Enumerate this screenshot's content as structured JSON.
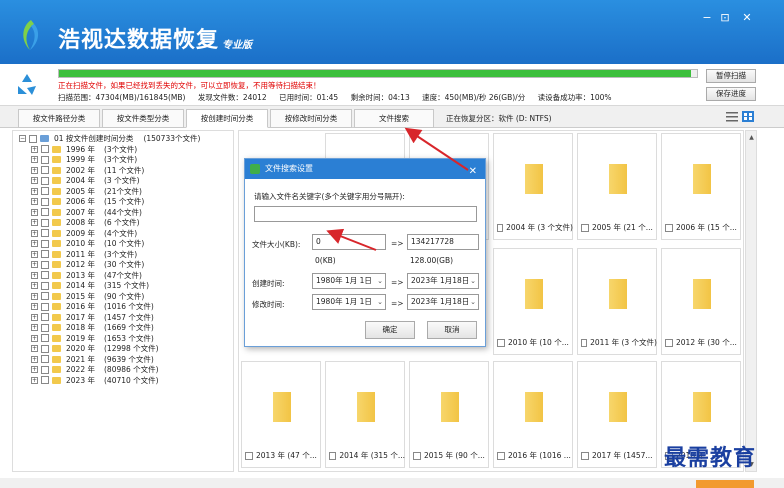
{
  "app": {
    "title": "浩视达数据恢复",
    "edition": "专业版"
  },
  "window_controls": {
    "minimize": "−",
    "restore": "⊡",
    "close": "✕"
  },
  "scan": {
    "progress": 0.99,
    "warning": "正在扫描文件，如果已经找到丢失的文件，可以立即恢复，不用等待扫描结束！",
    "stats": {
      "range": "扫描范围：47304(MB)/161845(MB)",
      "found": "发现文件数：24012",
      "elapsed": "已用时间：01:45",
      "remaining": "剩余时间：04:13",
      "speed": "速度：450(MB)/秒 26(GB)/分",
      "success_rate": "读设备成功率：100%"
    },
    "pause_label": "暂停扫描",
    "save_label": "保存进度"
  },
  "tabs": [
    {
      "label": "按文件路径分类"
    },
    {
      "label": "按文件类型分类"
    },
    {
      "label": "按创建时间分类"
    },
    {
      "label": "按修改时间分类"
    },
    {
      "label": "文件搜索"
    }
  ],
  "restore_area": "正在恢复分区：软件 (D: NTFS)",
  "tree": {
    "root": "01 按文件创建时间分类",
    "root_count": "(150733个文件)",
    "items": [
      {
        "year": "1996 年",
        "count": "(3个文件)"
      },
      {
        "year": "1999 年",
        "count": "(3个文件)"
      },
      {
        "year": "2002 年",
        "count": "(11 个文件)"
      },
      {
        "year": "2004 年",
        "count": "(3 个文件)"
      },
      {
        "year": "2005 年",
        "count": "(21个文件)"
      },
      {
        "year": "2006 年",
        "count": "(15 个文件)"
      },
      {
        "year": "2007 年",
        "count": "(44个文件)"
      },
      {
        "year": "2008 年",
        "count": "(6 个文件)"
      },
      {
        "year": "2009 年",
        "count": "(4个文件)"
      },
      {
        "year": "2010 年",
        "count": "(10 个文件)"
      },
      {
        "year": "2011 年",
        "count": "(3个文件)"
      },
      {
        "year": "2012 年",
        "count": "(30 个文件)"
      },
      {
        "year": "2013 年",
        "count": "(47个文件)"
      },
      {
        "year": "2014 年",
        "count": "(315 个文件)"
      },
      {
        "year": "2015 年",
        "count": "(90 个文件)"
      },
      {
        "year": "2016 年",
        "count": "(1016 个文件)"
      },
      {
        "year": "2017 年",
        "count": "(1457 个文件)"
      },
      {
        "year": "2018 年",
        "count": "(1669 个文件)"
      },
      {
        "year": "2019 年",
        "count": "(1653 个文件)"
      },
      {
        "year": "2020 年",
        "count": "(12998 个文件)"
      },
      {
        "year": "2021 年",
        "count": "(9639 个文件)"
      },
      {
        "year": "2022 年",
        "count": "(80986 个文件)"
      },
      {
        "year": "2023 年",
        "count": "(40710 个文件)"
      }
    ]
  },
  "grid": {
    "row1": [
      "",
      "",
      "2004 年 (3 个文件)",
      "2005 年 (21 个...",
      "2006 年 (15 个..."
    ],
    "row2": [
      "2010 年 (10 个...",
      "2011 年 (3 个文件)",
      "2012 年 (30 个..."
    ],
    "row3": [
      "2013 年 (47 个...",
      "2014 年 (315 个...",
      "2015 年 (90 个...",
      "2016 年 (1016 ...",
      "2017 年 (1457...",
      "2018 年"
    ]
  },
  "dialog": {
    "title": "文件搜索设置",
    "close": "✕",
    "keyword_label": "请输入文件名关键字(多个关键字用分号隔开):",
    "keyword_value": "",
    "size_label": "文件大小(KB):",
    "size_min": "0",
    "size_max": "134217728",
    "arrow": "=>",
    "size_min_note": "0(KB)",
    "size_max_note": "128.00(GB)",
    "created_label": "创建时间:",
    "modified_label": "修改时间:",
    "date_from": "1980年 1月 1日",
    "date_to": "2023年 1月18日",
    "ok": "确定",
    "cancel": "取消"
  },
  "watermark": "最需教育",
  "colors": {
    "title_bar": "#1b6fc8",
    "progress": "#3cbf3c",
    "warning": "#e00000",
    "annotation_arrow": "#d8262b",
    "folder": "#f2c445"
  }
}
